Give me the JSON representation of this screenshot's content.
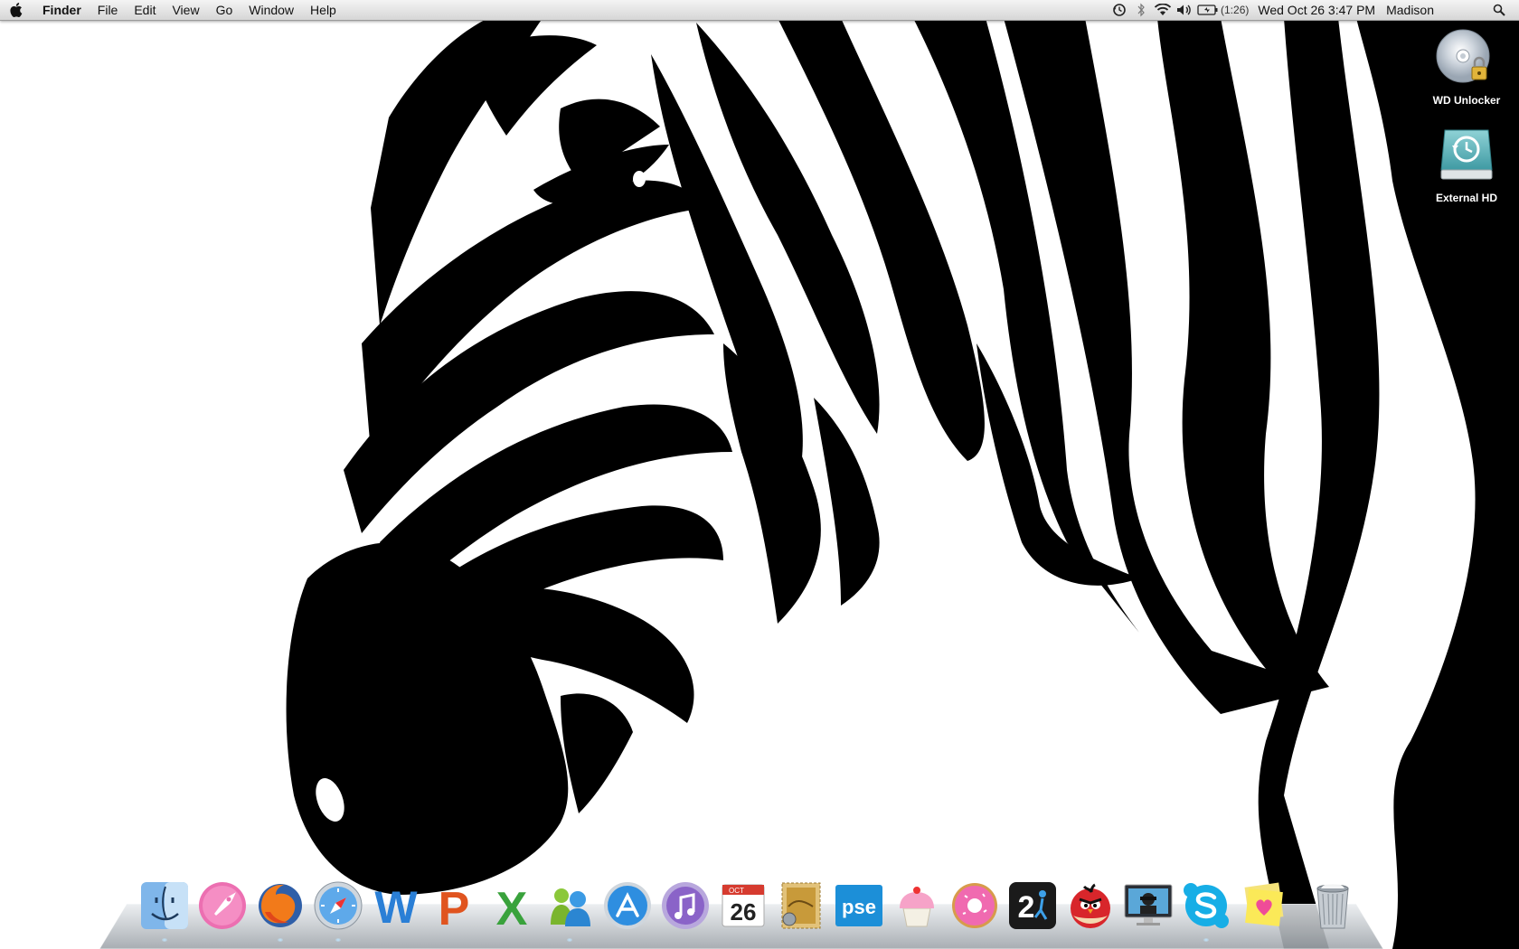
{
  "menubar": {
    "app_name": "Finder",
    "menus": [
      "File",
      "Edit",
      "View",
      "Go",
      "Window",
      "Help"
    ],
    "battery_time": "(1:26)",
    "clock": "Wed Oct 26  3:47 PM",
    "user": "Madison",
    "status_icons": [
      "time-machine-icon",
      "bluetooth-icon",
      "wifi-icon",
      "volume-icon",
      "battery-icon",
      "spotlight-icon"
    ]
  },
  "desktop": {
    "icons": [
      {
        "label": "WD Unlocker",
        "icon": "cd-disc-lock-icon"
      },
      {
        "label": "External HD",
        "icon": "time-machine-drive-icon"
      }
    ]
  },
  "dock": {
    "apps": [
      "finder-icon",
      "launchpad-icon",
      "firefox-icon",
      "safari-icon",
      "word-icon",
      "powerpoint-icon",
      "excel-icon",
      "messenger-icon",
      "app-store-icon",
      "itunes-icon",
      "ical-icon",
      "mail-stamp-icon",
      "photoshop-elements-icon",
      "cupcake-icon",
      "donut-icon",
      "portal-2-icon",
      "angry-birds-icon",
      "photo-booth-icon",
      "skype-icon",
      "stickies-icon",
      "trash-icon"
    ],
    "ical_month": "OCT",
    "ical_day": "26",
    "pse_label": "pse",
    "portal_label": "2",
    "word_letter": "W",
    "powerpoint_letter": "P",
    "excel_letter": "X"
  },
  "colors": {
    "menubar": "#e4e4e4",
    "wallpaper_stripes": "#000000",
    "wallpaper_bg": "#ffffff"
  }
}
